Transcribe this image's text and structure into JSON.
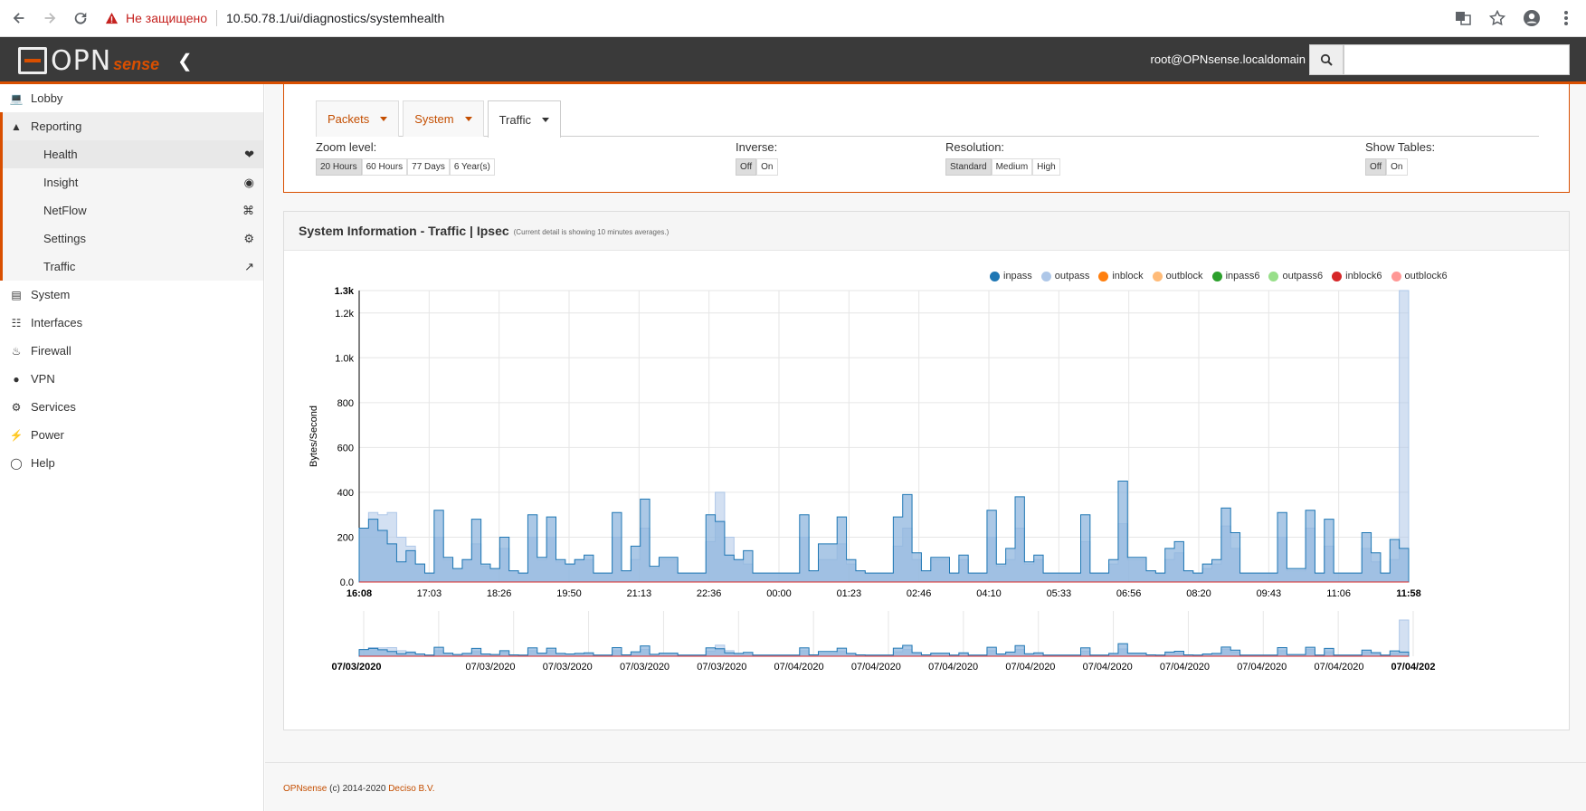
{
  "browser": {
    "security_warning": "Не защищено",
    "url": "10.50.78.1/ui/diagnostics/systemhealth"
  },
  "header": {
    "logo_main": "OPN",
    "logo_sense": "sense",
    "user": "root@OPNsense.localdomain",
    "search_placeholder": ""
  },
  "sidebar": {
    "items": [
      {
        "label": "Lobby",
        "icon": "laptop-icon"
      },
      {
        "label": "Reporting",
        "icon": "area-chart-icon"
      },
      {
        "label": "System",
        "icon": "server-icon"
      },
      {
        "label": "Interfaces",
        "icon": "sitemap-icon"
      },
      {
        "label": "Firewall",
        "icon": "fire-icon"
      },
      {
        "label": "VPN",
        "icon": "globe-icon"
      },
      {
        "label": "Services",
        "icon": "cog-icon"
      },
      {
        "label": "Power",
        "icon": "plug-icon"
      },
      {
        "label": "Help",
        "icon": "life-ring-icon"
      }
    ],
    "reporting_sub": [
      {
        "label": "Health",
        "icon": "heartbeat-icon"
      },
      {
        "label": "Insight",
        "icon": "binoculars-icon"
      },
      {
        "label": "NetFlow",
        "icon": "rss-icon"
      },
      {
        "label": "Settings",
        "icon": "cog-icon"
      },
      {
        "label": "Traffic",
        "icon": "line-chart-icon"
      }
    ]
  },
  "tabs": [
    "Packets",
    "System",
    "Traffic"
  ],
  "options": {
    "zoom": {
      "label": "Zoom level:",
      "buttons": [
        "20 Hours",
        "60 Hours",
        "77 Days",
        "6 Year(s)"
      ]
    },
    "inverse": {
      "label": "Inverse:",
      "buttons": [
        "Off",
        "On"
      ]
    },
    "resolution": {
      "label": "Resolution:",
      "buttons": [
        "Standard",
        "Medium",
        "High"
      ]
    },
    "tables": {
      "label": "Show Tables:",
      "buttons": [
        "Off",
        "On"
      ]
    }
  },
  "panel": {
    "title": "System Information - Traffic | Ipsec",
    "note": "(Current detail is showing 10 minutes averages.)"
  },
  "footer": {
    "brand": "OPNsense",
    "copy": " (c) 2014-2020 ",
    "company": "Deciso B.V."
  },
  "colors": {
    "accent": "#d94f00",
    "inpass": "#1f77b4",
    "outpass": "#aec7e8"
  },
  "chart_data": {
    "type": "area",
    "ylabel": "Bytes/Second",
    "ylim": [
      0,
      1300
    ],
    "yticks": [
      "0.0",
      "200",
      "400",
      "600",
      "800",
      "1.0k",
      "1.2k",
      "1.3k"
    ],
    "ytick_values": [
      0,
      200,
      400,
      600,
      800,
      1000,
      1200,
      1300
    ],
    "xticks": [
      "16:08",
      "17:03",
      "18:26",
      "19:50",
      "21:13",
      "22:36",
      "00:00",
      "01:23",
      "02:46",
      "04:10",
      "05:33",
      "06:56",
      "08:20",
      "09:43",
      "11:06",
      "11:58"
    ],
    "context_xticks": [
      "07/03/2020",
      "07/03/2020",
      "07/03/2020",
      "07/03/2020",
      "07/03/2020",
      "07/04/2020",
      "07/04/2020",
      "07/04/2020",
      "07/04/2020",
      "07/04/2020",
      "07/04/2020",
      "07/04/2020",
      "07/04/2020",
      "07/04/202"
    ],
    "legend": [
      "inpass",
      "outpass",
      "inblock",
      "outblock",
      "inpass6",
      "outpass6",
      "inblock6",
      "outblock6"
    ],
    "legend_colors": [
      "#1f77b4",
      "#aec7e8",
      "#ff7f0e",
      "#ffbb78",
      "#2ca02c",
      "#98df8a",
      "#d62728",
      "#ff9896"
    ],
    "series": [
      {
        "name": "inpass",
        "values": [
          240,
          280,
          230,
          170,
          90,
          140,
          80,
          40,
          320,
          110,
          60,
          100,
          280,
          80,
          60,
          200,
          50,
          40,
          300,
          110,
          290,
          100,
          80,
          100,
          120,
          40,
          40,
          310,
          50,
          160,
          370,
          70,
          110,
          110,
          40,
          40,
          40,
          300,
          270,
          120,
          100,
          140,
          40,
          40,
          40,
          40,
          40,
          300,
          50,
          170,
          170,
          290,
          100,
          50,
          40,
          40,
          40,
          290,
          390,
          130,
          50,
          110,
          110,
          40,
          120,
          40,
          40,
          320,
          80,
          150,
          380,
          90,
          120,
          40,
          40,
          40,
          40,
          300,
          40,
          40,
          100,
          450,
          110,
          110,
          50,
          40,
          150,
          180,
          50,
          40,
          80,
          100,
          330,
          220,
          40,
          40,
          40,
          40,
          310,
          60,
          60,
          320,
          40,
          280,
          40,
          40,
          40,
          220,
          130,
          40,
          190,
          150
        ]
      },
      {
        "name": "outpass",
        "values": [
          240,
          310,
          300,
          310,
          200,
          160,
          80,
          40,
          200,
          100,
          60,
          100,
          170,
          70,
          60,
          150,
          50,
          40,
          200,
          100,
          200,
          90,
          80,
          100,
          100,
          40,
          40,
          200,
          50,
          100,
          240,
          60,
          100,
          100,
          40,
          40,
          40,
          180,
          400,
          200,
          100,
          80,
          40,
          40,
          40,
          40,
          40,
          200,
          50,
          100,
          100,
          170,
          80,
          50,
          40,
          40,
          40,
          160,
          240,
          100,
          50,
          100,
          100,
          40,
          100,
          40,
          40,
          200,
          70,
          100,
          240,
          80,
          100,
          40,
          40,
          40,
          40,
          180,
          40,
          40,
          80,
          260,
          100,
          100,
          50,
          40,
          100,
          130,
          50,
          40,
          60,
          80,
          250,
          150,
          40,
          40,
          40,
          40,
          200,
          50,
          50,
          240,
          40,
          160,
          40,
          40,
          40,
          150,
          90,
          40,
          100,
          1300
        ]
      }
    ],
    "context_ylim": [
      0,
      1300
    ]
  }
}
